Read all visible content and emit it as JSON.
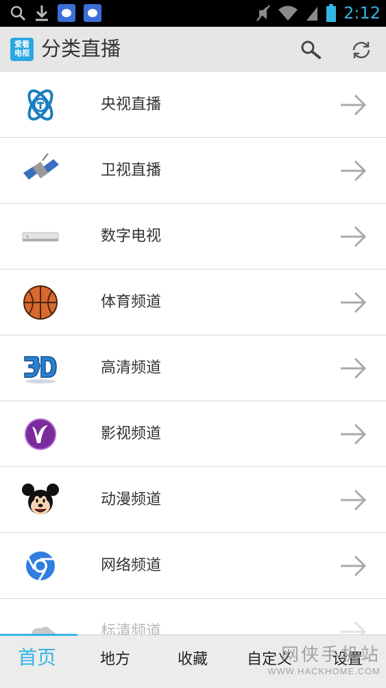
{
  "status_bar": {
    "time": "2:12",
    "icons": [
      "search-icon",
      "download-icon",
      "baidu-icon",
      "baidu-icon",
      "mute-icon",
      "wifi-icon",
      "signal-icon",
      "battery-icon"
    ]
  },
  "action_bar": {
    "app_icon_text_line1": "爱看",
    "app_icon_text_line2": "电视",
    "title": "分类直播",
    "actions": [
      "search-icon",
      "refresh-icon"
    ]
  },
  "categories": [
    {
      "label": "央视直播",
      "icon": "cctv-icon"
    },
    {
      "label": "卫视直播",
      "icon": "satellite-icon"
    },
    {
      "label": "数字电视",
      "icon": "set-top-box-icon"
    },
    {
      "label": "体育频道",
      "icon": "basketball-icon"
    },
    {
      "label": "高清频道",
      "icon": "3d-icon"
    },
    {
      "label": "影视频道",
      "icon": "movie-v-icon"
    },
    {
      "label": "动漫频道",
      "icon": "mickey-icon"
    },
    {
      "label": "网络频道",
      "icon": "chrome-icon"
    },
    {
      "label": "标清频道",
      "icon": "cloud-icon"
    }
  ],
  "bottom_nav": {
    "items": [
      "首页",
      "地方",
      "收藏",
      "自定义",
      "设置"
    ],
    "active_index": 0
  },
  "watermark": {
    "cn": "网侠手机站",
    "en": "WWW.HACKHOME.COM"
  },
  "colors": {
    "accent": "#33b5e5",
    "action_bar_bg": "#e6e6e6",
    "status_bar_bg": "#000000"
  }
}
